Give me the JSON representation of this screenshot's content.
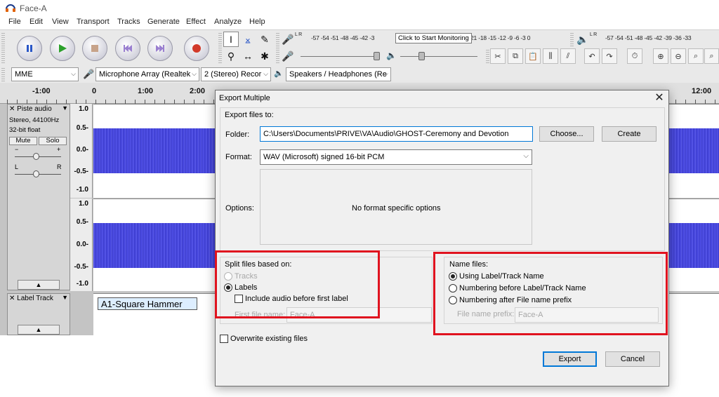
{
  "window": {
    "title": "Face-A"
  },
  "menu": [
    "File",
    "Edit",
    "View",
    "Transport",
    "Tracks",
    "Generate",
    "Effect",
    "Analyze",
    "Help"
  ],
  "meters": {
    "record_scale": "-57 -54 -51 -48 -45 -42 -3",
    "record_scale_tail": "21 -18 -15 -12  -9  -6  -3  0",
    "play_scale": "-57 -54 -51 -48 -45 -42 -39 -36 -33",
    "record_channels": "L R",
    "play_channels": "L R"
  },
  "tooltip": "Click to Start Monitoring",
  "device_toolbar": {
    "host": "MME",
    "recording_device": "Microphone Array (Realtek",
    "channels": "2 (Stereo) Recor",
    "playback_device": "Speakers / Headphones (Re"
  },
  "ruler": {
    "labels": [
      "-1:00",
      "0",
      "1:00",
      "2:00",
      "12:00"
    ]
  },
  "audio_track": {
    "name": "Piste audio",
    "info_line1": "Stereo, 44100Hz",
    "info_line2": "32-bit float",
    "mute_label": "Mute",
    "solo_label": "Solo",
    "gain_minus": "−",
    "gain_plus": "+",
    "pan_left": "L",
    "pan_right": "R",
    "scale_top": [
      "1.0",
      "0.5-",
      "0.0-",
      "-0.5-",
      "-1.0"
    ],
    "scale_bottom": [
      "1.0",
      "0.5-",
      "0.0-",
      "-0.5-",
      "-1.0"
    ]
  },
  "label_track": {
    "name": "Label Track",
    "label_text": "A1-Square Hammer"
  },
  "dialog": {
    "title": "Export Multiple",
    "export_to_label": "Export files to:",
    "folder_label": "Folder:",
    "folder_value": "C:\\Users\\Documents\\PRIVE\\VA\\Audio\\GHOST-Ceremony and Devotion",
    "choose_button": "Choose...",
    "create_button": "Create",
    "format_label": "Format:",
    "format_value": "WAV (Microsoft) signed 16-bit PCM",
    "options_label": "Options:",
    "options_text": "No format specific options",
    "split_group_label": "Split files based on:",
    "split_tracks": "Tracks",
    "split_labels": "Labels",
    "include_audio_label": "Include audio before first label",
    "first_file_name_label": "First file name:",
    "first_file_name_value": "Face-A",
    "name_group_label": "Name files:",
    "name_using_label": "Using Label/Track Name",
    "name_numbering_before": "Numbering before Label/Track Name",
    "name_numbering_after": "Numbering after File name prefix",
    "file_prefix_label": "File name prefix:",
    "file_prefix_value": "Face-A",
    "overwrite_label": "Overwrite existing files",
    "export_button": "Export",
    "cancel_button": "Cancel",
    "close_glyph": "✕"
  },
  "colors": {
    "waveform": "#3a3ad8",
    "highlight": "#e0131f",
    "accent": "#0078d7"
  }
}
